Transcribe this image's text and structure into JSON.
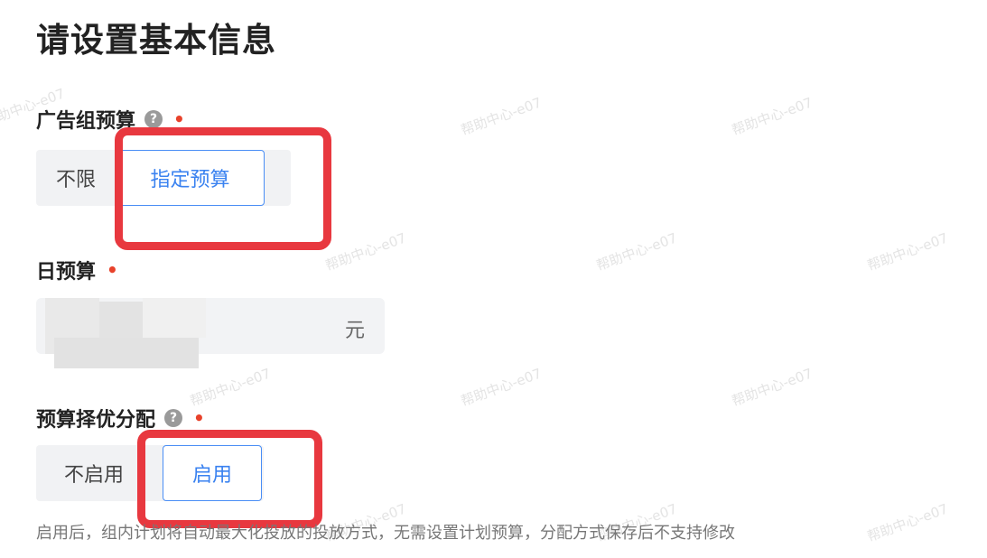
{
  "title": "请设置基本信息",
  "watermark_text": "帮助中心-e07",
  "ad_group_budget": {
    "label": "广告组预算",
    "help_icon": "question-circle-icon",
    "required_mark": "•",
    "options": [
      "不限",
      "指定预算"
    ],
    "selected": "指定预算"
  },
  "daily_budget": {
    "label": "日预算",
    "required_mark": "•",
    "value": "",
    "unit": "元"
  },
  "budget_optimization": {
    "label": "预算择优分配",
    "help_icon": "question-circle-icon",
    "required_mark": "•",
    "options": [
      "不启用",
      "启用"
    ],
    "selected": "启用",
    "hint": "启用后，组内计划将自动最大化投放的投放方式，无需设置计划预算，分配方式保存后不支持修改"
  },
  "colors": {
    "accent": "#3a82f0",
    "required": "#e8422b",
    "highlight_box": "#e8383f",
    "segment_bg": "#f1f2f4"
  }
}
